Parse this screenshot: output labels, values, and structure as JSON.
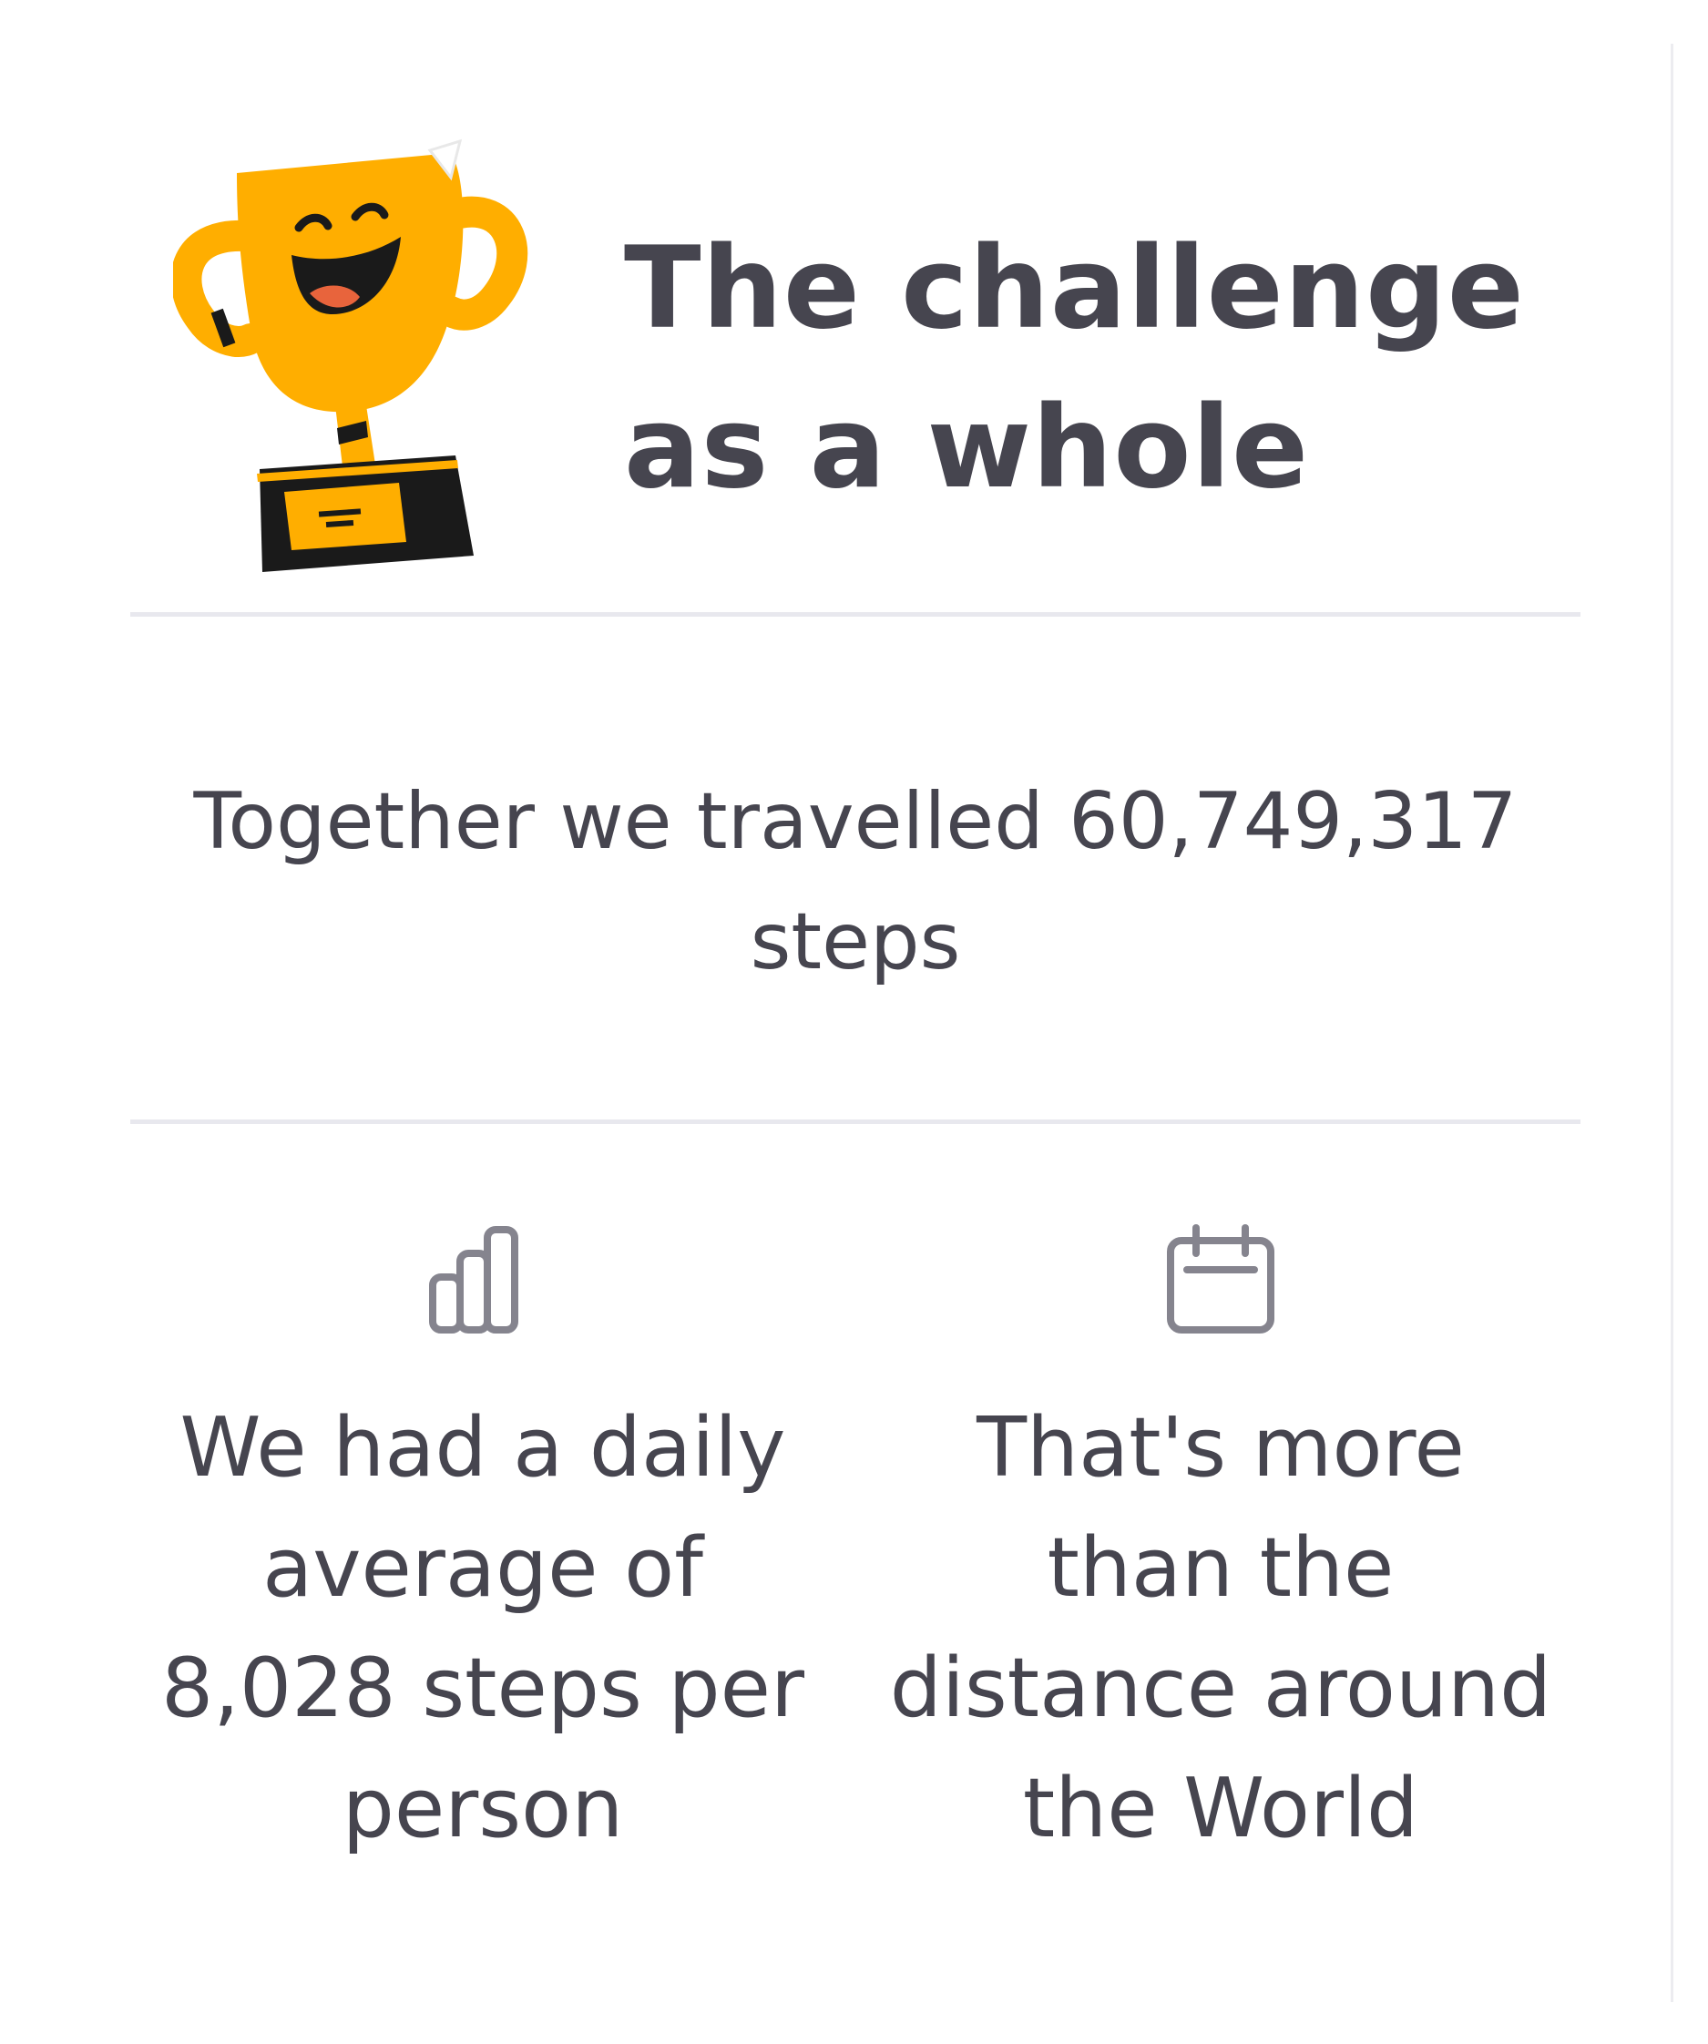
{
  "header": {
    "title": "The challenge as a whole",
    "trophy_icon": "trophy-icon"
  },
  "summary": {
    "total_steps": "Together we travelled 60,749,317 steps"
  },
  "stats": [
    {
      "icon": "bar-chart-icon",
      "text": "We had a daily average of 8,028 steps per person"
    },
    {
      "icon": "calendar-icon",
      "text": "That's more than the distance around the World"
    }
  ],
  "colors": {
    "text": "#46454f",
    "trophy": "#ffae00",
    "icon_gray": "#85848e",
    "divider": "#e8e8ee"
  }
}
